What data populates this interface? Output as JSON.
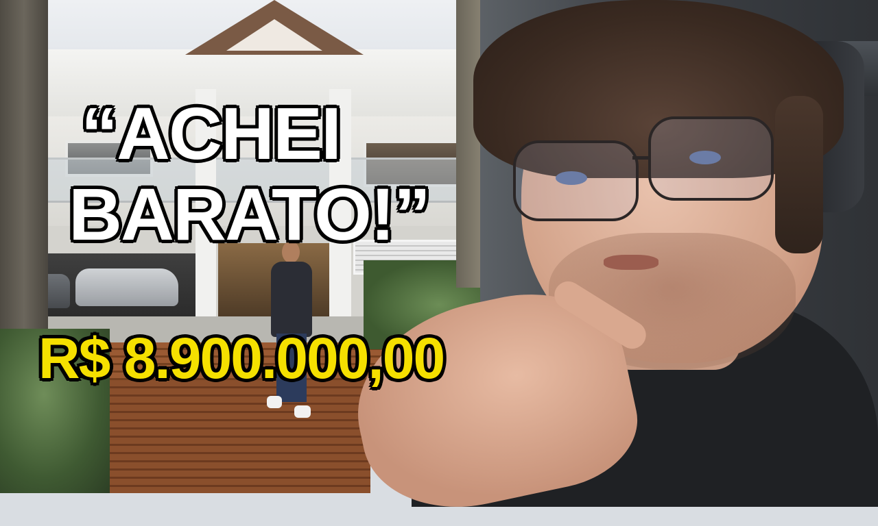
{
  "captions": {
    "quote_line1": "“ACHEI",
    "quote_line2": "BARATO!”",
    "price": "R$ 8.900.000,00"
  },
  "colors": {
    "quote_text": "#ffffff",
    "price_text": "#f5e000",
    "outline": "#000000"
  }
}
